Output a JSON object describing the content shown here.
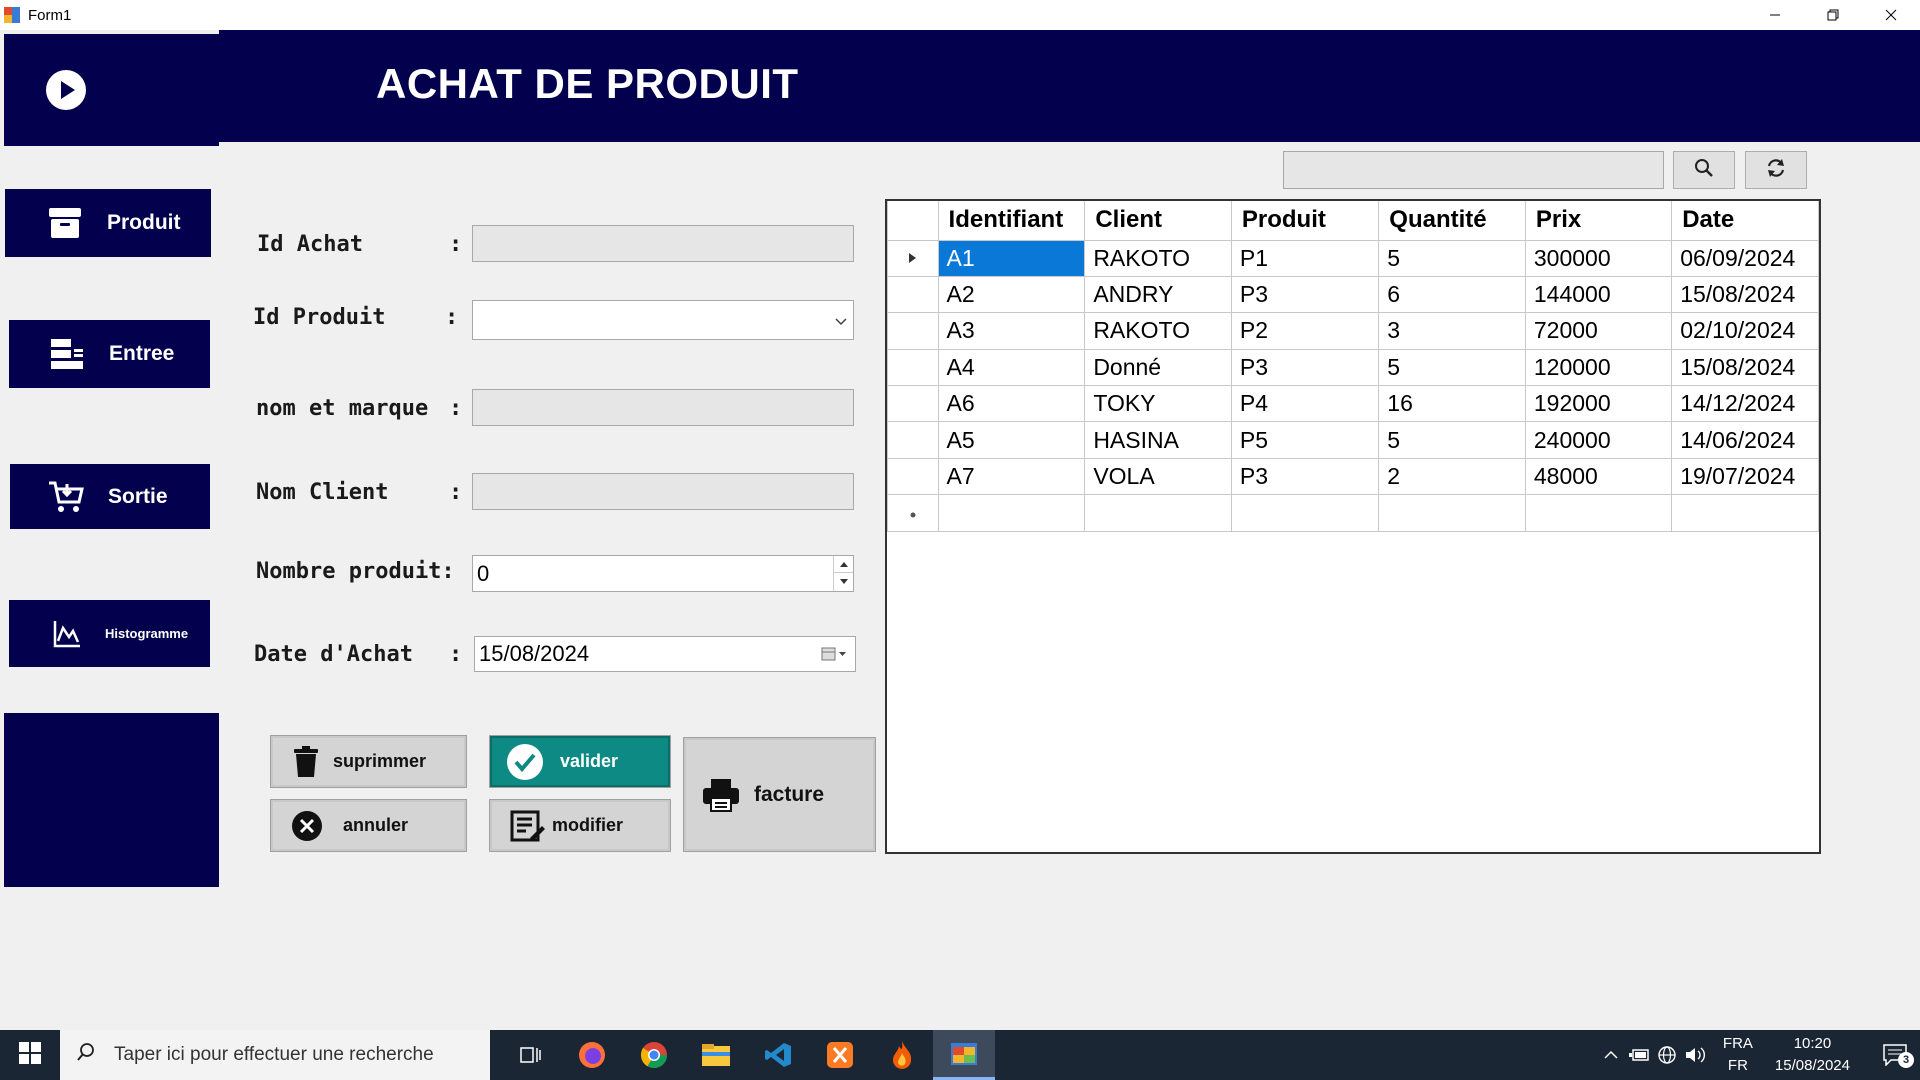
{
  "window": {
    "title": "Form1"
  },
  "header": {
    "title": "ACHAT DE PRODUIT"
  },
  "sidebar": {
    "items": [
      {
        "label": "Produit",
        "icon": "archive-icon"
      },
      {
        "label": "Entree",
        "icon": "inbox-list-icon"
      },
      {
        "label": "Sortie",
        "icon": "cart-icon"
      },
      {
        "label": "Histogramme",
        "icon": "chart-icon"
      }
    ]
  },
  "form": {
    "id_achat_label": "Id Achat",
    "id_produit_label": "Id Produit",
    "nom_marque_label": "nom et marque",
    "nom_client_label": "Nom Client",
    "nombre_produit_label": "Nombre produit:",
    "date_achat_label": "Date d'Achat",
    "colon": ":",
    "id_achat_value": "",
    "id_produit_value": "",
    "nom_marque_value": "",
    "nom_client_value": "",
    "nombre_produit_value": "0",
    "date_achat_value": "15/08/2024"
  },
  "buttons": {
    "supprimer": "suprimmer",
    "valider": "valider",
    "annuler": "annuler",
    "modifier": "modifier",
    "facture": "facture"
  },
  "search": {
    "value": ""
  },
  "table": {
    "headers": [
      "Identifiant",
      "Client",
      "Produit",
      "Quantité",
      "Prix",
      "Date"
    ],
    "rows": [
      [
        "A1",
        "RAKOTO",
        "P1",
        "5",
        "300000",
        "06/09/2024"
      ],
      [
        "A2",
        "ANDRY",
        "P3",
        "6",
        "144000",
        "15/08/2024"
      ],
      [
        "A3",
        "RAKOTO",
        "P2",
        "3",
        "72000",
        "02/10/2024"
      ],
      [
        "A4",
        "Donné",
        "P3",
        "5",
        "120000",
        "15/08/2024"
      ],
      [
        "A6",
        "TOKY",
        "P4",
        "16",
        "192000",
        "14/12/2024"
      ],
      [
        "A5",
        "HASINA",
        "P5",
        "5",
        "240000",
        "14/06/2024"
      ],
      [
        "A7",
        "VOLA",
        "P3",
        "2",
        "48000",
        "19/07/2024"
      ]
    ]
  },
  "taskbar": {
    "search_placeholder": "Taper ici pour effectuer une recherche",
    "lang_top": "FRA",
    "lang_bottom": "FR",
    "time": "10:20",
    "date": "15/08/2024",
    "notif_count": "3"
  },
  "colors": {
    "navy": "#03004d",
    "teal": "#0e8a84",
    "selection": "#0a78d7"
  }
}
